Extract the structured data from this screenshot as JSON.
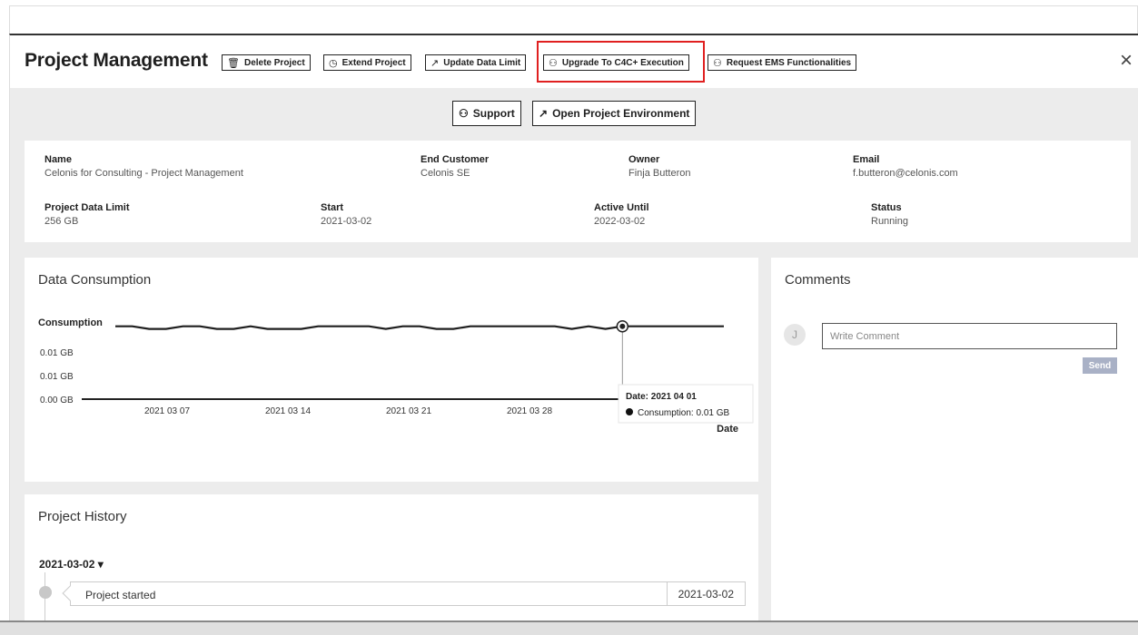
{
  "header": {
    "title": "Project Management",
    "buttons": {
      "delete": "Delete Project",
      "extend": "Extend Project",
      "update": "Update Data Limit",
      "upgrade": "Upgrade To C4C+ Execution",
      "request": "Request EMS Functionalities"
    },
    "close_icon": "×"
  },
  "actions": {
    "support": "Support",
    "open_env": "Open Project Environment"
  },
  "info": {
    "name_label": "Name",
    "name_value": "Celonis for Consulting - Project Management",
    "end_customer_label": "End Customer",
    "end_customer_value": "Celonis SE",
    "owner_label": "Owner",
    "owner_value": "Finja Butteron",
    "email_label": "Email",
    "email_value": "f.butteron@celonis.com",
    "data_limit_label": "Project Data Limit",
    "data_limit_value": "256 GB",
    "start_label": "Start",
    "start_value": "2021-03-02",
    "active_until_label": "Active Until",
    "active_until_value": "2022-03-02",
    "status_label": "Status",
    "status_value": "Running"
  },
  "data_consumption": {
    "title": "Data Consumption",
    "tooltip_date": "Date: 2021 04 01",
    "tooltip_value": "Consumption: 0.01 GB"
  },
  "comments": {
    "title": "Comments",
    "avatar_initial": "J",
    "placeholder": "Write Comment",
    "send_label": "Send"
  },
  "history": {
    "title": "Project History",
    "date_group": "2021-03-02 ▾",
    "entry_text": "Project started",
    "entry_date": "2021-03-02"
  },
  "chart_data": {
    "type": "line",
    "ylabel": "Consumption",
    "xlabel": "Date",
    "y_tick_labels": [
      "0.01 GB",
      "0.01 GB",
      "0.00 GB"
    ],
    "x_tick_labels": [
      "2021 03 07",
      "2021 03 14",
      "2021 03 21",
      "2021 03 28"
    ],
    "x": [
      "2021 03 02",
      "2021 03 03",
      "2021 03 04",
      "2021 03 05",
      "2021 03 06",
      "2021 03 07",
      "2021 03 08",
      "2021 03 09",
      "2021 03 10",
      "2021 03 11",
      "2021 03 12",
      "2021 03 13",
      "2021 03 14",
      "2021 03 15",
      "2021 03 16",
      "2021 03 17",
      "2021 03 18",
      "2021 03 19",
      "2021 03 20",
      "2021 03 21",
      "2021 03 22",
      "2021 03 23",
      "2021 03 24",
      "2021 03 25",
      "2021 03 26",
      "2021 03 27",
      "2021 03 28",
      "2021 03 29",
      "2021 03 30",
      "2021 03 31",
      "2021 04 01",
      "2021 04 02",
      "2021 04 03",
      "2021 04 04",
      "2021 04 05",
      "2021 04 06",
      "2021 04 07"
    ],
    "series": [
      {
        "name": "Consumption",
        "values": [
          0.0112,
          0.0112,
          0.0108,
          0.0108,
          0.0112,
          0.0112,
          0.0108,
          0.0108,
          0.0112,
          0.0108,
          0.0108,
          0.0108,
          0.0112,
          0.0112,
          0.0112,
          0.0112,
          0.0108,
          0.0112,
          0.0112,
          0.0108,
          0.0108,
          0.0112,
          0.0112,
          0.0112,
          0.0112,
          0.0112,
          0.0112,
          0.0108,
          0.0112,
          0.0108,
          0.0112,
          0.0112,
          0.0112,
          0.0112,
          0.0112,
          0.0112,
          0.0112
        ]
      }
    ],
    "ylim": [
      0,
      0.012
    ],
    "highlighted_point": {
      "x": "2021 04 01",
      "value": 0.01
    }
  }
}
